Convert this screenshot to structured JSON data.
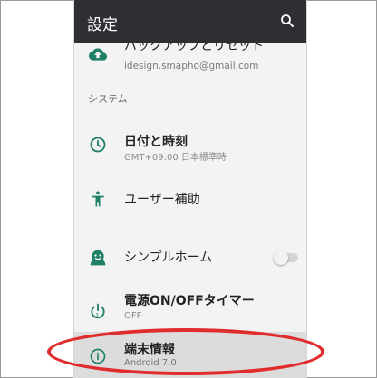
{
  "header": {
    "title": "設定"
  },
  "items": {
    "backup": {
      "title": "バックアップとリセット",
      "subtitle": "idesign.smapho@gmail.com"
    },
    "section_system": "システム",
    "datetime": {
      "title": "日付と時刻",
      "subtitle": "GMT+09:00 日本標準時"
    },
    "accessibility": {
      "title": "ユーザー補助"
    },
    "simple_home": {
      "title": "シンプルホーム",
      "toggle_on": false
    },
    "power_timer": {
      "title": "電源ON/OFFタイマー",
      "subtitle": "OFF"
    },
    "about": {
      "title": "端末情報",
      "subtitle": "Android 7.0"
    }
  },
  "colors": {
    "header_bg": "#2d2f33",
    "icon_green": "#1f7f67",
    "annotation_red": "#e02c2c"
  }
}
